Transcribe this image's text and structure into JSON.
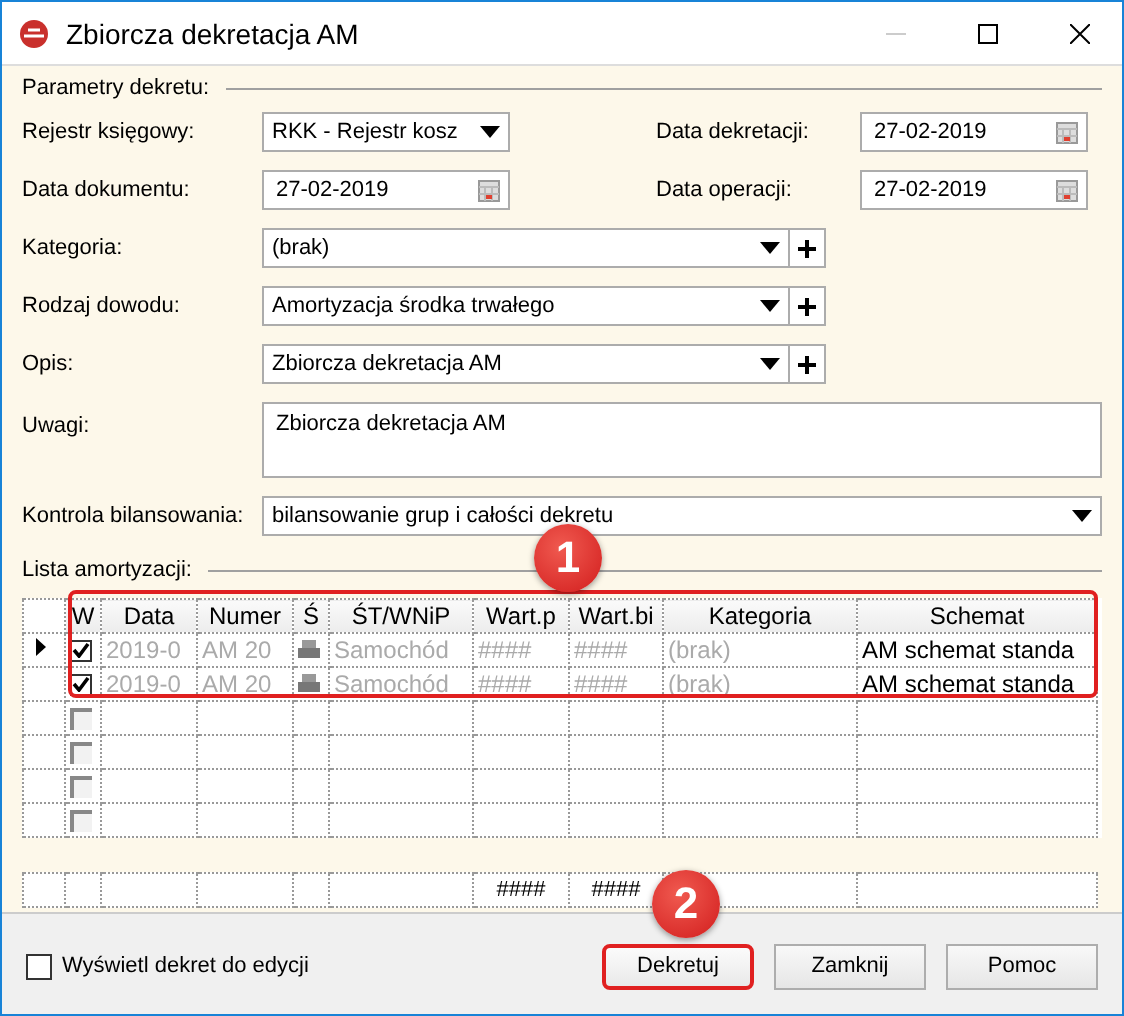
{
  "window": {
    "title": "Zbiorcza dekretacja AM"
  },
  "params": {
    "title": "Parametry dekretu:",
    "pairs": [
      {
        "label": "Rejestr księgowy:",
        "kind": "combo",
        "value": "RKK - Rejestr kosz"
      },
      {
        "label": "Data dekretacji:",
        "kind": "date",
        "value": "27-02-2019"
      },
      {
        "label": "Data dokumentu:",
        "kind": "date",
        "value": "27-02-2019"
      },
      {
        "label": "Data operacji:",
        "kind": "date",
        "value": "27-02-2019"
      }
    ],
    "fields": [
      {
        "label": "Kategoria:",
        "kind": "combo_plus",
        "value": "(brak)"
      },
      {
        "label": "Rodzaj dowodu:",
        "kind": "combo_plus",
        "value": "Amortyzacja środka trwałego"
      },
      {
        "label": "Opis:",
        "kind": "combo_plus",
        "value": "Zbiorcza dekretacja AM"
      },
      {
        "label": "Uwagi:",
        "kind": "textarea",
        "value": "Zbiorcza dekretacja AM"
      },
      {
        "label": "Kontrola bilansowania:",
        "kind": "combo_wide",
        "value": "bilansowanie grup i całości dekretu"
      }
    ]
  },
  "list": {
    "title": "Lista amortyzacji:",
    "check_column": "W",
    "columns": [
      "Data",
      "Numer",
      "Ś",
      "ŚT/WNiP",
      "Wart.p",
      "Wart.bi",
      "Kategoria",
      "Schemat"
    ],
    "rows": [
      {
        "current": true,
        "checked": true,
        "enabled": true,
        "cells": [
          "2019-0",
          "AM 20",
          "",
          "Samochód",
          "####",
          "####",
          "(brak)",
          "AM schemat standa"
        ]
      },
      {
        "current": false,
        "checked": true,
        "enabled": true,
        "cells": [
          "2019-0",
          "AM 20",
          "",
          "Samochód",
          "####",
          "####",
          "(brak)",
          "AM schemat standa"
        ]
      },
      {
        "current": false,
        "checked": false,
        "enabled": false,
        "cells": []
      },
      {
        "current": false,
        "checked": false,
        "enabled": false,
        "cells": []
      },
      {
        "current": false,
        "checked": false,
        "enabled": false,
        "cells": []
      },
      {
        "current": false,
        "checked": false,
        "enabled": false,
        "cells": []
      }
    ],
    "totals": {
      "wart_p": "####",
      "wart_bi": "####"
    }
  },
  "footer": {
    "option": {
      "label": "Wyświetl dekret do edycji",
      "checked": false
    },
    "buttons": [
      {
        "label": "Dekretuj",
        "highlighted": true
      },
      {
        "label": "Zamknij",
        "highlighted": false
      },
      {
        "label": "Pomoc",
        "highlighted": false
      }
    ]
  },
  "callouts": [
    {
      "kind": "rows",
      "label": "1"
    },
    {
      "kind": "button",
      "label": "2"
    }
  ]
}
